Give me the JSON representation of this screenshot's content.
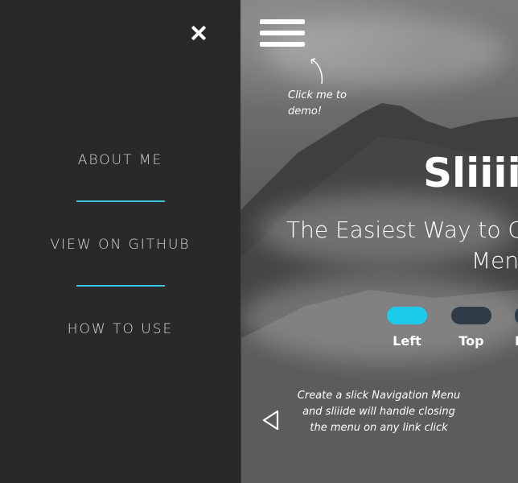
{
  "sidebar": {
    "items": [
      {
        "label": "ABOUT ME"
      },
      {
        "label": "VIEW ON GITHUB"
      },
      {
        "label": "HOW TO USE"
      }
    ],
    "accent_color": "#35c4e0",
    "close_icon": "close-icon"
  },
  "hero": {
    "hint_click": "Click me to demo!",
    "title": "Sliiii",
    "subtitle_line1": "The Easiest Way to C",
    "subtitle_line2": "Menu",
    "toggles": [
      {
        "label": "Left",
        "active": true,
        "color": "#1ccbec"
      },
      {
        "label": "Top",
        "active": false,
        "color": "#2f3b46"
      },
      {
        "label": "R",
        "active": false,
        "color": "#2f3b46"
      }
    ],
    "hint_bottom": "Create a slick Navigation Menu and sliiide will handle closing the menu on any link click"
  }
}
